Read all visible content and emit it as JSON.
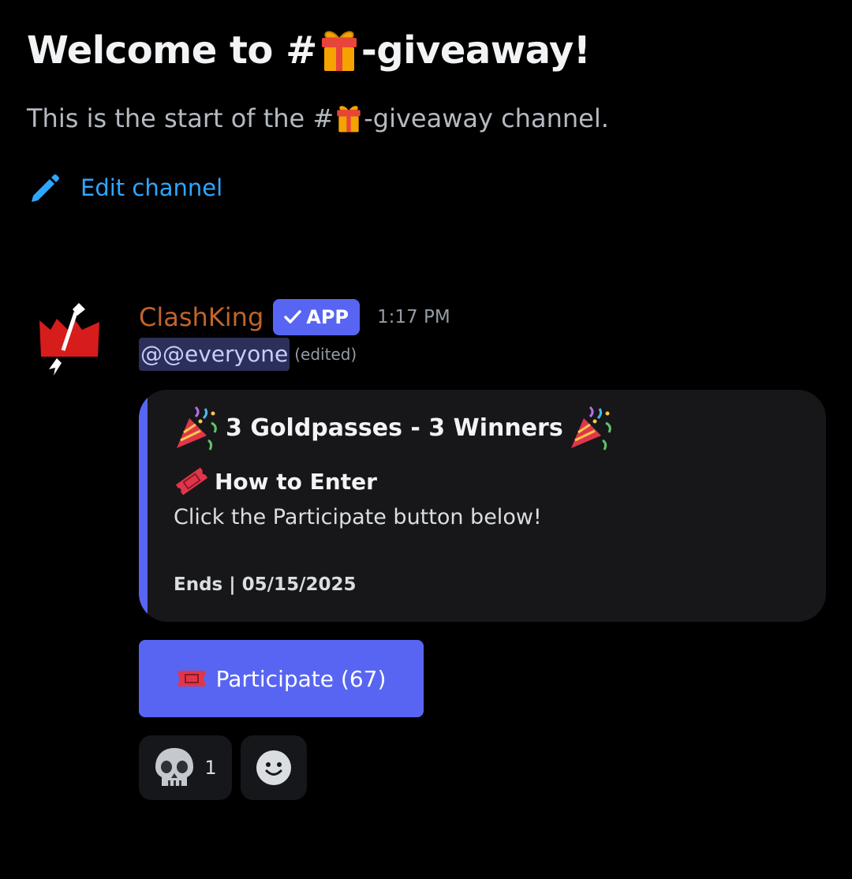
{
  "channel_intro": {
    "title_prefix": "Welcome to #",
    "title_suffix": "-giveaway!",
    "subtitle_prefix": "This is the start of the #",
    "subtitle_suffix": "-giveaway channel.",
    "edit_label": "Edit channel"
  },
  "message": {
    "author": "ClashKing",
    "badge": "APP",
    "timestamp": "1:17 PM",
    "mention": "@@everyone",
    "edited": "(edited)",
    "embed": {
      "title": "3 Goldpasses - 3 Winners",
      "field_name": "How to Enter",
      "field_value": "Click the Participate button below!",
      "footer": "Ends | 05/15/2025"
    },
    "button": {
      "label": "Participate (67)"
    },
    "reactions": [
      {
        "emoji": "skull-icon",
        "count": "1"
      }
    ]
  },
  "colors": {
    "background": "#000000",
    "accent": "#5865f2",
    "author": "#c1642a",
    "link": "#2ea7ff",
    "embed_bg": "#17171a"
  }
}
